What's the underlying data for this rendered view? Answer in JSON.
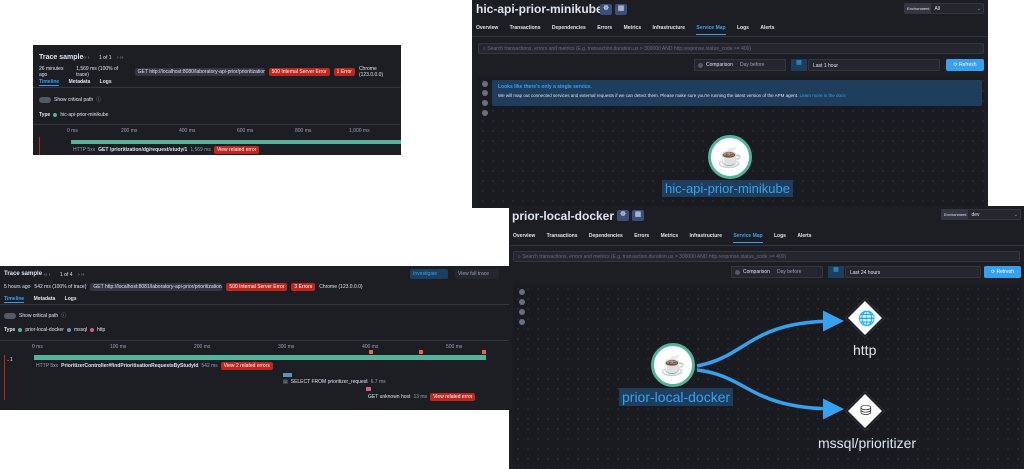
{
  "trace1": {
    "title": "Trace sample",
    "pager": "1 of 1",
    "age": "26 minutes ago",
    "duration": "1,569 ms (100% of trace)",
    "request": "GET http://localhost:8080/laboratory-api-prior/prioritization/dg/reque...",
    "status": "500 Internal Server Error",
    "errors": "1 Error",
    "browser": "Chrome (123.0.0.0)",
    "tabs": [
      "Timeline",
      "Metadata",
      "Logs"
    ],
    "critical_path": "Show critical path",
    "type_label": "Type",
    "service": "hic-api-prior-minikube",
    "axis": [
      "0 ms",
      "200 ms",
      "400 ms",
      "600 ms",
      "800 ms",
      "1,000 ms",
      "1,200 ms"
    ],
    "span_type": "HTTP 5xx",
    "span_name": "GET /prioritization/dg/request/study/1",
    "span_duration": "1,569 ms",
    "span_error": "View related error"
  },
  "trace2": {
    "title": "Trace sample",
    "pager": "1 of 4",
    "investigate": "Investigate",
    "full_trace": "View full trace",
    "age": "5 hours ago",
    "duration": "542 ms (100% of trace)",
    "request": "GET http://localhost:8081/laboratory-api-prior/prioritization/dg/reque...",
    "status": "500 Internal Server Error",
    "errors": "3 Errors",
    "browser": "Chrome (123.0.0.0)",
    "tabs": [
      "Timeline",
      "Metadata",
      "Logs"
    ],
    "critical_path": "Show critical path",
    "type_label": "Type",
    "legend": [
      "prior-local-docker",
      "mssql",
      "http"
    ],
    "axis": [
      "0 ms",
      "100 ms",
      "200 ms",
      "300 ms",
      "400 ms",
      "500 ms"
    ],
    "row_count": "1",
    "span1_type": "HTTP 5xx",
    "span1_name": "PrioritizerController#findPrioritisationRequestsByStudyId",
    "span1_duration": "542 ms",
    "span1_error": "View 2 related errors",
    "span2_name": "SELECT FROM prioritizer_request",
    "span2_duration": "6.7 ms",
    "span3_name": "GET unknown host",
    "span3_duration": "13 ms",
    "span3_error": "View related error"
  },
  "apm1": {
    "title": "hic-api-prior-minikube",
    "env_label": "Environment",
    "env_value": "All",
    "tabs": [
      "Overview",
      "Transactions",
      "Dependencies",
      "Errors",
      "Metrics",
      "Infrastructure",
      "Service Map",
      "Logs",
      "Alerts"
    ],
    "search_placeholder": "Search transactions, errors and metrics (E.g. transaction.duration.us > 300000 AND http.response.status_code >= 400)",
    "comparison": "Comparison",
    "comparison_value": "Day before",
    "date_range": "Last 1 hour",
    "refresh": "Refresh",
    "callout_title": "Looks like there's only a single service.",
    "callout_text": "We will map out connected services and external requests if we can detect them. Please make sure you're running the latest version of the APM agent.",
    "callout_link": "Learn more in the docs",
    "node_label": "hic-api-prior-minikube"
  },
  "apm2": {
    "title": "prior-local-docker",
    "env_label": "Environment",
    "env_value": "dev",
    "tabs": [
      "Overview",
      "Transactions",
      "Dependencies",
      "Errors",
      "Metrics",
      "Infrastructure",
      "Service Map",
      "Logs",
      "Alerts"
    ],
    "search_placeholder": "Search transactions, errors and metrics (E.g. transaction.duration.us > 300000 AND http.response.status_code >= 400)",
    "comparison": "Comparison",
    "comparison_value": "Day before",
    "date_range": "Last 24 hours",
    "refresh": "Refresh",
    "node_label": "prior-local-docker",
    "dep1": "http",
    "dep2": "mssql/prioritizer"
  },
  "colors": {
    "accent": "#36a2ef",
    "service": "#54b399",
    "error": "#bd271e",
    "panel": "#1d1e24"
  },
  "icons": [
    "java-icon",
    "kubernetes-icon",
    "docker-icon",
    "globe-icon",
    "database-icon",
    "refresh-icon",
    "calendar-icon",
    "search-icon"
  ]
}
